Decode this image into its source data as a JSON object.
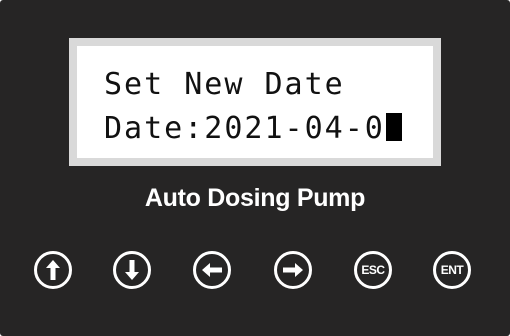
{
  "lcd": {
    "line1": "Set New Date",
    "line2": "Date:2021-04-0"
  },
  "device_label": "Auto Dosing Pump",
  "buttons": {
    "up_icon": "arrow-up-icon",
    "down_icon": "arrow-down-icon",
    "left_icon": "arrow-left-icon",
    "right_icon": "arrow-right-icon",
    "esc_label": "ESC",
    "ent_label": "ENT"
  },
  "colors": {
    "panel": "#262525",
    "lcd_frame": "#d9d9d9",
    "lcd_screen": "#ffffff",
    "text": "#ffffff"
  }
}
